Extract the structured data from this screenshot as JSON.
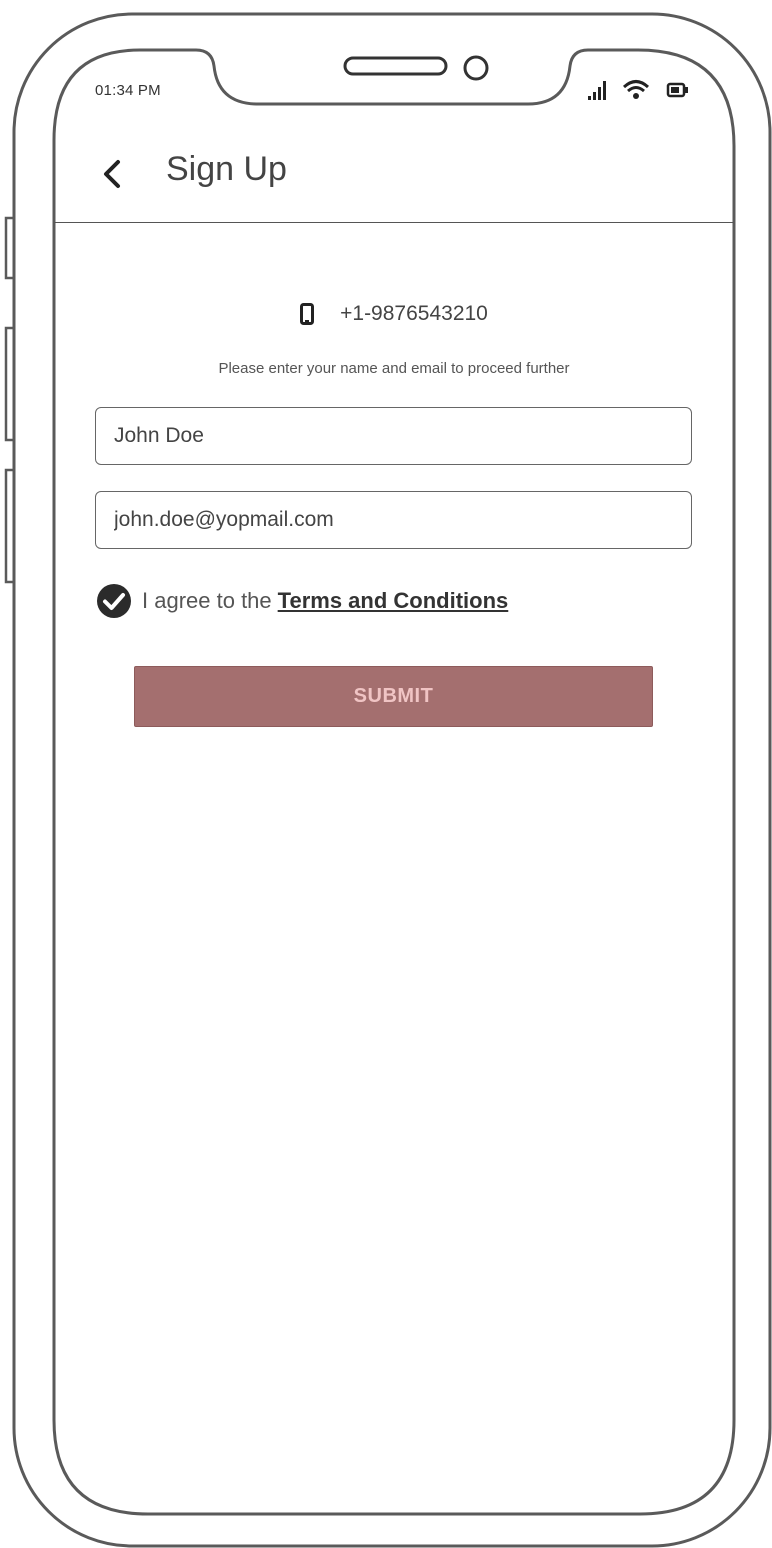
{
  "status_bar": {
    "time": "01:34 PM",
    "icons": [
      "signal-icon",
      "wifi-icon",
      "battery-icon"
    ]
  },
  "header": {
    "back_icon": "chevron-left-icon",
    "title": "Sign Up"
  },
  "phone": {
    "icon": "mobile-phone-icon",
    "number": "+1-9876543210"
  },
  "form": {
    "hint": "Please enter your name and email to proceed further",
    "name_value": "John Doe",
    "email_value": "john.doe@yopmail.com",
    "agree": {
      "checked": true,
      "prefix": "I agree to the",
      "link_label": "Terms and Conditions"
    },
    "submit_label": "SUBMIT"
  },
  "colors": {
    "submit_bg": "#a46f6f",
    "submit_text": "#f0c4c4",
    "frame": "#5a5a5a",
    "text": "#444444"
  }
}
